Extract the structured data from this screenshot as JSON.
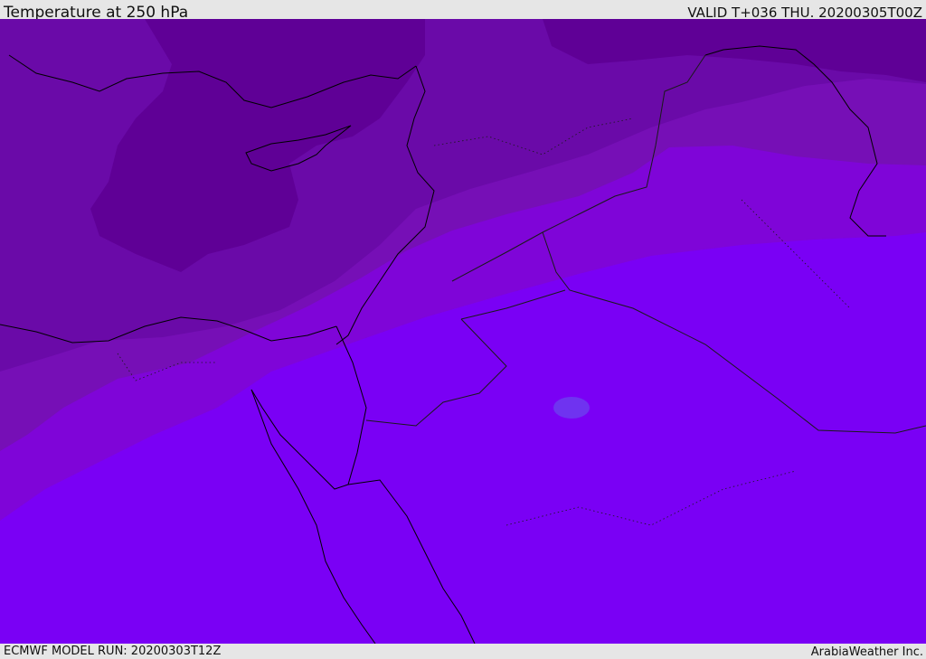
{
  "header": {
    "title": "Temperature at 250 hPa",
    "valid": "VALID T+036 THU. 20200305T00Z"
  },
  "footer": {
    "model_run": "ECMWF MODEL RUN: 20200303T12Z",
    "brand": "ArabiaWeather Inc."
  },
  "map": {
    "variable": "temperature",
    "level": "250 hPa",
    "colors": {
      "coldest": "#5f0096",
      "cold": "#6a0aa8",
      "cool": "#760fb6",
      "mild": "#7f05d8",
      "warm": "#7a00f5",
      "warm_patch": "#6f33f0",
      "coastline": "#000000",
      "border": "#1a1a1a"
    }
  }
}
